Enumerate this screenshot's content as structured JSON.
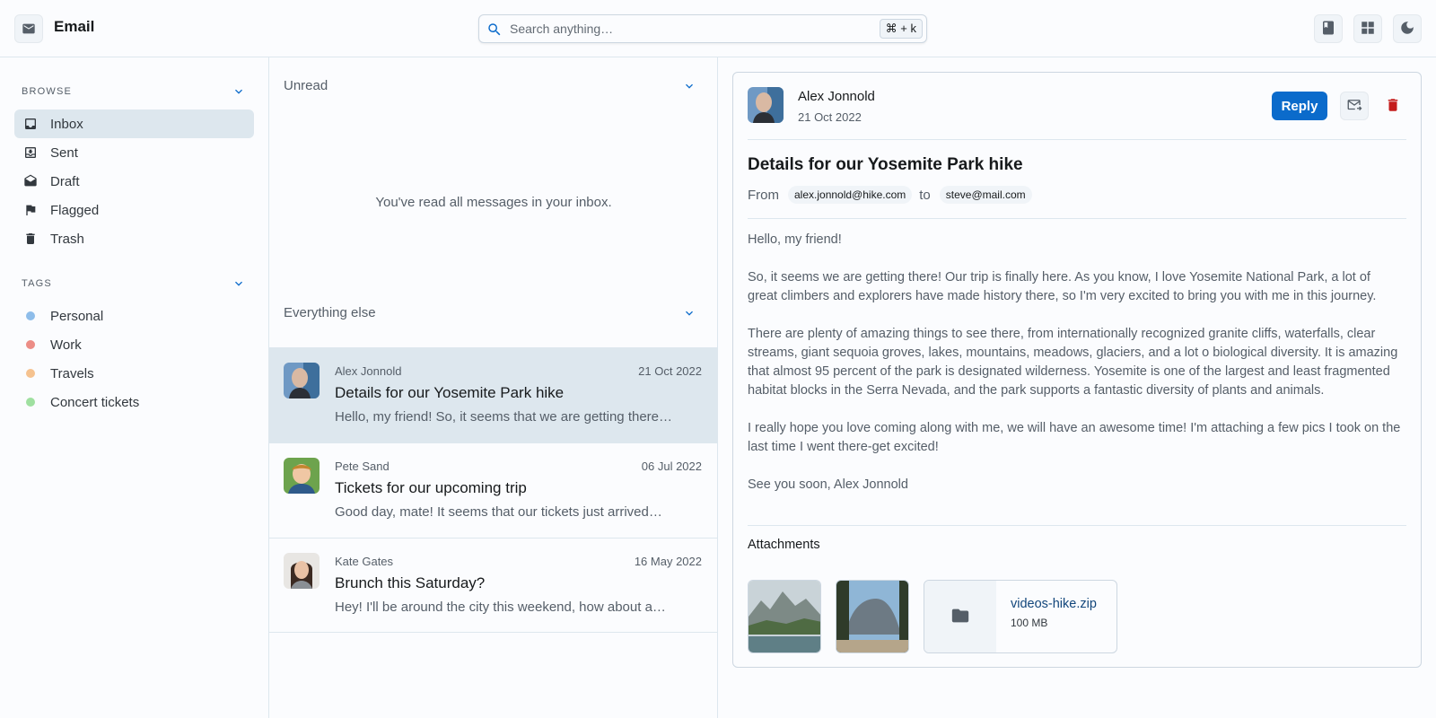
{
  "app": {
    "title": "Email"
  },
  "search": {
    "placeholder": "Search anything…",
    "shortcut": "⌘ + k"
  },
  "header_buttons": [
    "book-icon",
    "grid-icon",
    "moon-icon"
  ],
  "sidebar": {
    "browse_label": "Browse",
    "items": [
      {
        "label": "Inbox",
        "icon": "inbox-icon",
        "active": true
      },
      {
        "label": "Sent",
        "icon": "sent-icon"
      },
      {
        "label": "Draft",
        "icon": "draft-icon"
      },
      {
        "label": "Flagged",
        "icon": "flag-icon"
      },
      {
        "label": "Trash",
        "icon": "trash-icon"
      }
    ],
    "tags_label": "Tags",
    "tags": [
      {
        "label": "Personal",
        "color": "#8ebdea"
      },
      {
        "label": "Work",
        "color": "#ec8d86"
      },
      {
        "label": "Travels",
        "color": "#f5c28f"
      },
      {
        "label": "Concert tickets",
        "color": "#9fe0a0"
      }
    ]
  },
  "list": {
    "unread_label": "Unread",
    "unread_empty": "You've read all messages in your inbox.",
    "else_label": "Everything else",
    "items": [
      {
        "sender": "Alex Jonnold",
        "date": "21 Oct 2022",
        "subject": "Details for our Yosemite Park hike",
        "preview": "Hello, my friend! So, it seems that we are getting there…"
      },
      {
        "sender": "Pete Sand",
        "date": "06 Jul 2022",
        "subject": "Tickets for our upcoming trip",
        "preview": "Good day, mate! It seems that our tickets just arrived…"
      },
      {
        "sender": "Kate Gates",
        "date": "16 May 2022",
        "subject": "Brunch this Saturday?",
        "preview": "Hey! I'll be around the city this weekend, how about a…"
      }
    ]
  },
  "reader": {
    "sender": "Alex Jonnold",
    "date": "21 Oct 2022",
    "reply_label": "Reply",
    "subject": "Details for our Yosemite Park hike",
    "from_label": "From",
    "from_email": "alex.jonnold@hike.com",
    "to_label": "to",
    "to_email": "steve@mail.com",
    "paragraphs": [
      "Hello, my friend!",
      "So, it seems we are getting there! Our trip is finally here. As you know, I love Yosemite National Park, a lot of great climbers and explorers have made history there, so I'm very excited to bring you with me in this journey.",
      "There are plenty of amazing things to see there, from internationally recognized granite cliffs, waterfalls, clear streams, giant sequoia groves, lakes, mountains, meadows, glaciers, and a lot o biological diversity. It is amazing that almost 95 percent of the park is designated wilderness. Yosemite is one of the largest and least fragmented habitat blocks in the Serra Nevada, and the park supports a fantastic diversity of plants and animals.",
      "I really hope you love coming along with me, we will have an awesome time! I'm attaching a few pics I took on the last time I went there-get excited!",
      "See you soon, Alex Jonnold"
    ],
    "attachments_label": "Attachments",
    "file": {
      "name": "videos-hike.zip",
      "size": "100 MB"
    }
  },
  "colors": {
    "accent": "#0b6bcb",
    "danger": "#c41c1c",
    "selected_bg": "#dde7ee"
  }
}
